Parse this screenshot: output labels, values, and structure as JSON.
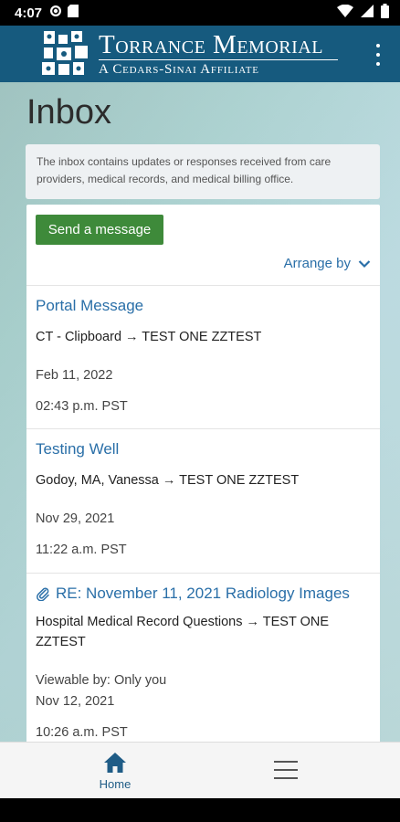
{
  "status_bar": {
    "time": "4:07",
    "icons": [
      "sync-icon",
      "sd-card-icon",
      "wifi-icon",
      "signal-icon",
      "battery-icon"
    ]
  },
  "header": {
    "brand_name": "Torrance Memorial",
    "affiliate": "A Cedars-Sinai Affiliate",
    "color": "#165a7e"
  },
  "page": {
    "title": "Inbox",
    "info": "The inbox contains updates or responses received from care providers, medical records, and medical billing office."
  },
  "actions": {
    "send_label": "Send a message",
    "arrange_label": "Arrange by"
  },
  "messages": [
    {
      "subject": "Portal Message",
      "route": "CT - Clipboard → TEST ONE ZZTEST",
      "date": "Feb 11, 2022",
      "time": "02:43 p.m. PST"
    },
    {
      "subject": "Testing Well",
      "route": "Godoy, MA, Vanessa → TEST ONE ZZTEST",
      "date": "Nov 29, 2021",
      "time": "11:22 a.m. PST"
    },
    {
      "subject": "RE: November 11, 2021 Radiology Images",
      "has_attachment": true,
      "route": "Hospital Medical Record Questions → TEST ONE ZZTEST",
      "viewable": "Viewable by: Only you",
      "date": "Nov 12, 2021",
      "time": "10:26 a.m. PST"
    }
  ],
  "bottom_nav": {
    "home_label": "Home"
  },
  "colors": {
    "accent": "#2a6fa8",
    "button": "#3e8a3a"
  }
}
